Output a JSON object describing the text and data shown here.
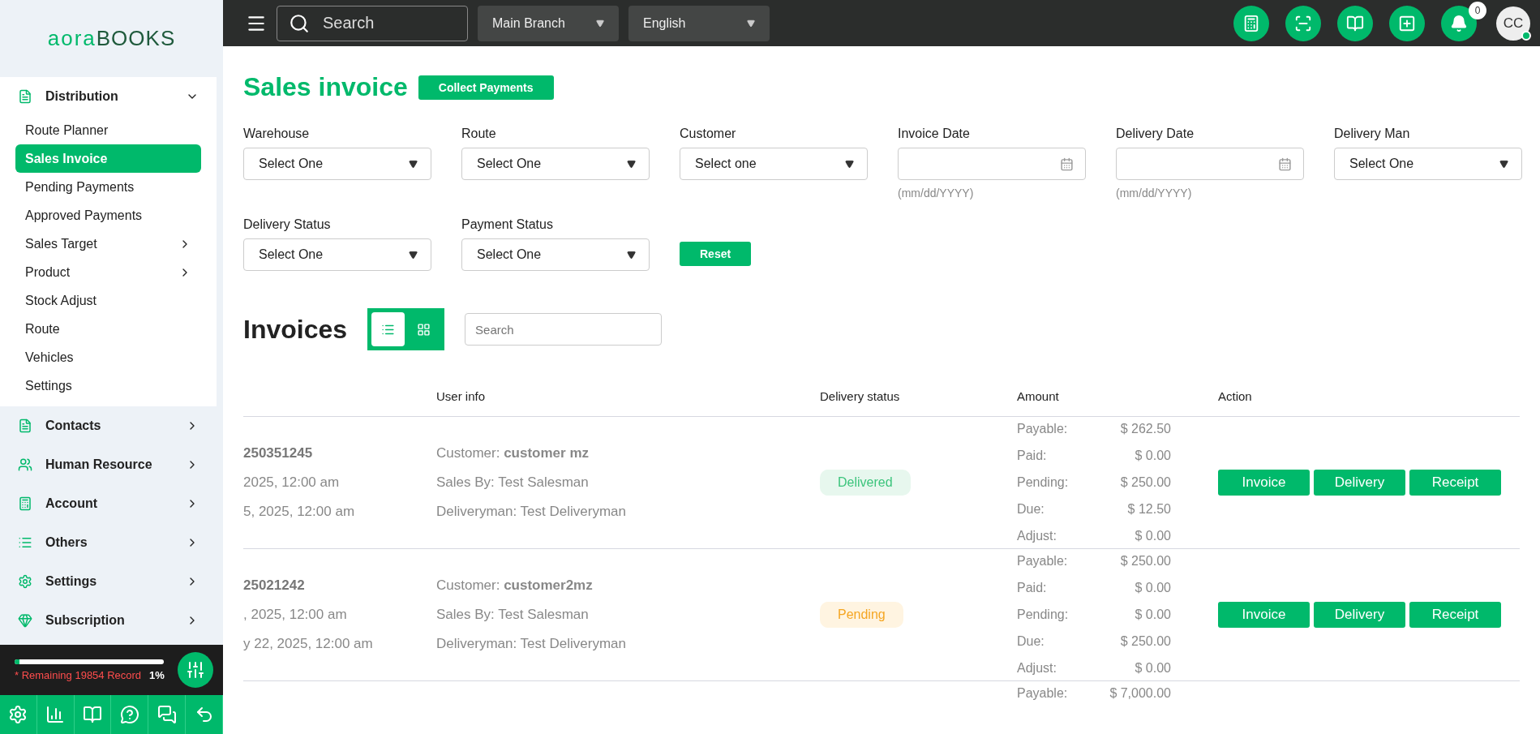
{
  "sidebar": {
    "logo": {
      "light": "aora",
      "bold": "BOOKS"
    },
    "nav": [
      {
        "label": "Distribution",
        "expanded": true,
        "children": [
          {
            "label": "Route Planner",
            "kind": "link",
            "selected": false
          },
          {
            "label": "Sales Invoice",
            "kind": "link",
            "selected": true
          },
          {
            "label": "Pending Payments",
            "kind": "link",
            "selected": false
          },
          {
            "label": "Approved Payments",
            "kind": "link",
            "selected": false
          },
          {
            "label": "Sales Target",
            "kind": "submenu",
            "selected": false
          },
          {
            "label": "Product",
            "kind": "submenu",
            "selected": false
          },
          {
            "label": "Stock Adjust",
            "kind": "link",
            "selected": false
          },
          {
            "label": "Route",
            "kind": "link",
            "selected": false
          },
          {
            "label": "Vehicles",
            "kind": "link",
            "selected": false
          },
          {
            "label": "Settings",
            "kind": "link",
            "selected": false
          }
        ]
      },
      {
        "label": "Contacts",
        "expanded": false
      },
      {
        "label": "Human Resource",
        "expanded": false
      },
      {
        "label": "Account",
        "expanded": false
      },
      {
        "label": "Others",
        "expanded": false
      },
      {
        "label": "Settings",
        "expanded": false
      },
      {
        "label": "Subscription",
        "expanded": false
      }
    ],
    "usage": {
      "level": 0.03,
      "remaining": "* Remaining 19854 Record",
      "percent": "1%"
    }
  },
  "topbar": {
    "search": {
      "placeholder": "Search"
    },
    "branch": "Main Branch",
    "language": "English",
    "notifications": "0",
    "avatar": "CC"
  },
  "page": {
    "title": "Sales invoice",
    "collect_button": "Collect Payments",
    "filters": [
      {
        "label": "Warehouse",
        "kind": "select",
        "value": "Select One"
      },
      {
        "label": "Route",
        "kind": "select",
        "value": "Select One"
      },
      {
        "label": "Customer",
        "kind": "select",
        "value": "Select one"
      },
      {
        "label": "Invoice Date",
        "kind": "date",
        "hint": "(mm/dd/YYYY)"
      },
      {
        "label": "Delivery Date",
        "kind": "date",
        "hint": "(mm/dd/YYYY)"
      },
      {
        "label": "Delivery Man",
        "kind": "select",
        "value": "Select One"
      },
      {
        "label": "Delivery Status",
        "kind": "select",
        "value": "Select One"
      },
      {
        "label": "Payment Status",
        "kind": "select",
        "value": "Select One"
      }
    ],
    "reset_button": "Reset",
    "invoices": {
      "title": "Invoices",
      "views": [
        {
          "kind": "list",
          "selected": true
        },
        {
          "kind": "grid",
          "selected": false
        }
      ],
      "search": {
        "placeholder": "Search"
      },
      "table": {
        "columns": [
          "User info",
          "Delivery status",
          "Amount",
          "Action"
        ],
        "rows": [
          {
            "column_1": [
              "250351245",
              "2025, 12:00 am",
              "5, 2025, 12:00 am"
            ],
            "customer": "Customer: **customer mz**",
            "sales_by": "Sales By: Test Salesman",
            "deliveryman": "Deliveryman: Test Deliveryman",
            "status": {
              "label": "Delivered",
              "kind": "delivered"
            },
            "amounts": [
              {
                "label": "Payable:",
                "value": "$ 262.50"
              },
              {
                "label": "Paid:",
                "value": "$ 0.00"
              },
              {
                "label": "Pending:",
                "value": "$ 250.00"
              },
              {
                "label": "Due:",
                "value": "$ 12.50"
              },
              {
                "label": "Adjust:",
                "value": "$ 0.00"
              }
            ],
            "actions": [
              "Invoice",
              "Delivery",
              "Receipt"
            ]
          },
          {
            "column_1": [
              "25021242",
              ", 2025, 12:00 am",
              "y 22, 2025, 12:00 am"
            ],
            "customer": "Customer: **customer2mz**",
            "sales_by": "Sales By: Test Salesman",
            "deliveryman": "Deliveryman: Test Deliveryman",
            "status": {
              "label": "Pending",
              "kind": "pending"
            },
            "amounts": [
              {
                "label": "Payable:",
                "value": "$ 250.00"
              },
              {
                "label": "Paid:",
                "value": "$ 0.00"
              },
              {
                "label": "Pending:",
                "value": "$ 0.00"
              },
              {
                "label": "Due:",
                "value": "$ 250.00"
              },
              {
                "label": "Adjust:",
                "value": "$ 0.00"
              }
            ],
            "actions": [
              "Invoice",
              "Delivery",
              "Receipt"
            ]
          },
          {
            "amounts": [
              {
                "label": "Payable:",
                "value": "$ 7,000.00"
              }
            ]
          }
        ]
      }
    }
  }
}
